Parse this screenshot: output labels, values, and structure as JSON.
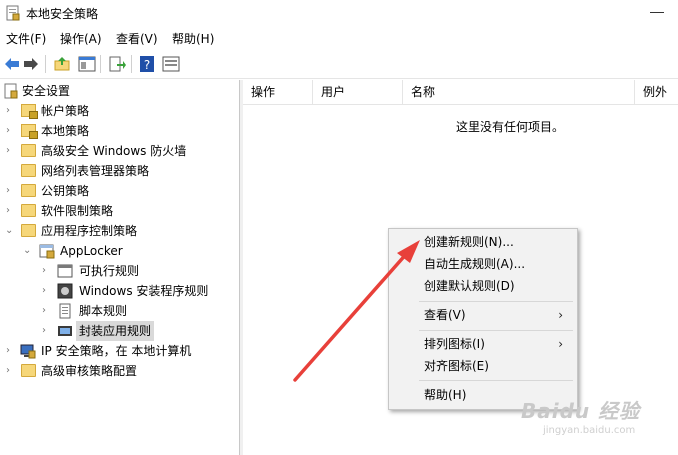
{
  "window": {
    "title": "本地安全策略"
  },
  "menu": [
    "文件(F)",
    "操作(A)",
    "查看(V)",
    "帮助(H)"
  ],
  "toolbar": [
    "back-icon",
    "forward-icon",
    "up-folder-icon",
    "console-tree-icon",
    "export-icon",
    "help-icon",
    "properties-icon"
  ],
  "tree": {
    "root": "安全设置",
    "items": [
      "帐户策略",
      "本地策略",
      "高级安全 Windows 防火墙",
      "网络列表管理器策略",
      "公钥策略",
      "软件限制策略",
      "应用程序控制策略",
      "AppLocker",
      "可执行规则",
      "Windows 安装程序规则",
      "脚本规则",
      "封装应用规则",
      "IP 安全策略，在 本地计算机",
      "高级审核策略配置"
    ]
  },
  "columns": [
    "操作",
    "用户",
    "名称",
    "例外"
  ],
  "empty_message": "这里没有任何项目。",
  "context_menu": {
    "items": [
      "创建新规则(N)...",
      "自动生成规则(A)...",
      "创建默认规则(D)",
      "查看(V)",
      "排列图标(I)",
      "对齐图标(E)",
      "帮助(H)"
    ],
    "submenu_arrow": "›"
  },
  "watermark": {
    "logo": "Baidu 经验",
    "url": "jingyan.baidu.com"
  },
  "colors": {
    "arrow": "#e8403a",
    "folder": "#f6d77a",
    "selection": "#d9d9d9"
  }
}
